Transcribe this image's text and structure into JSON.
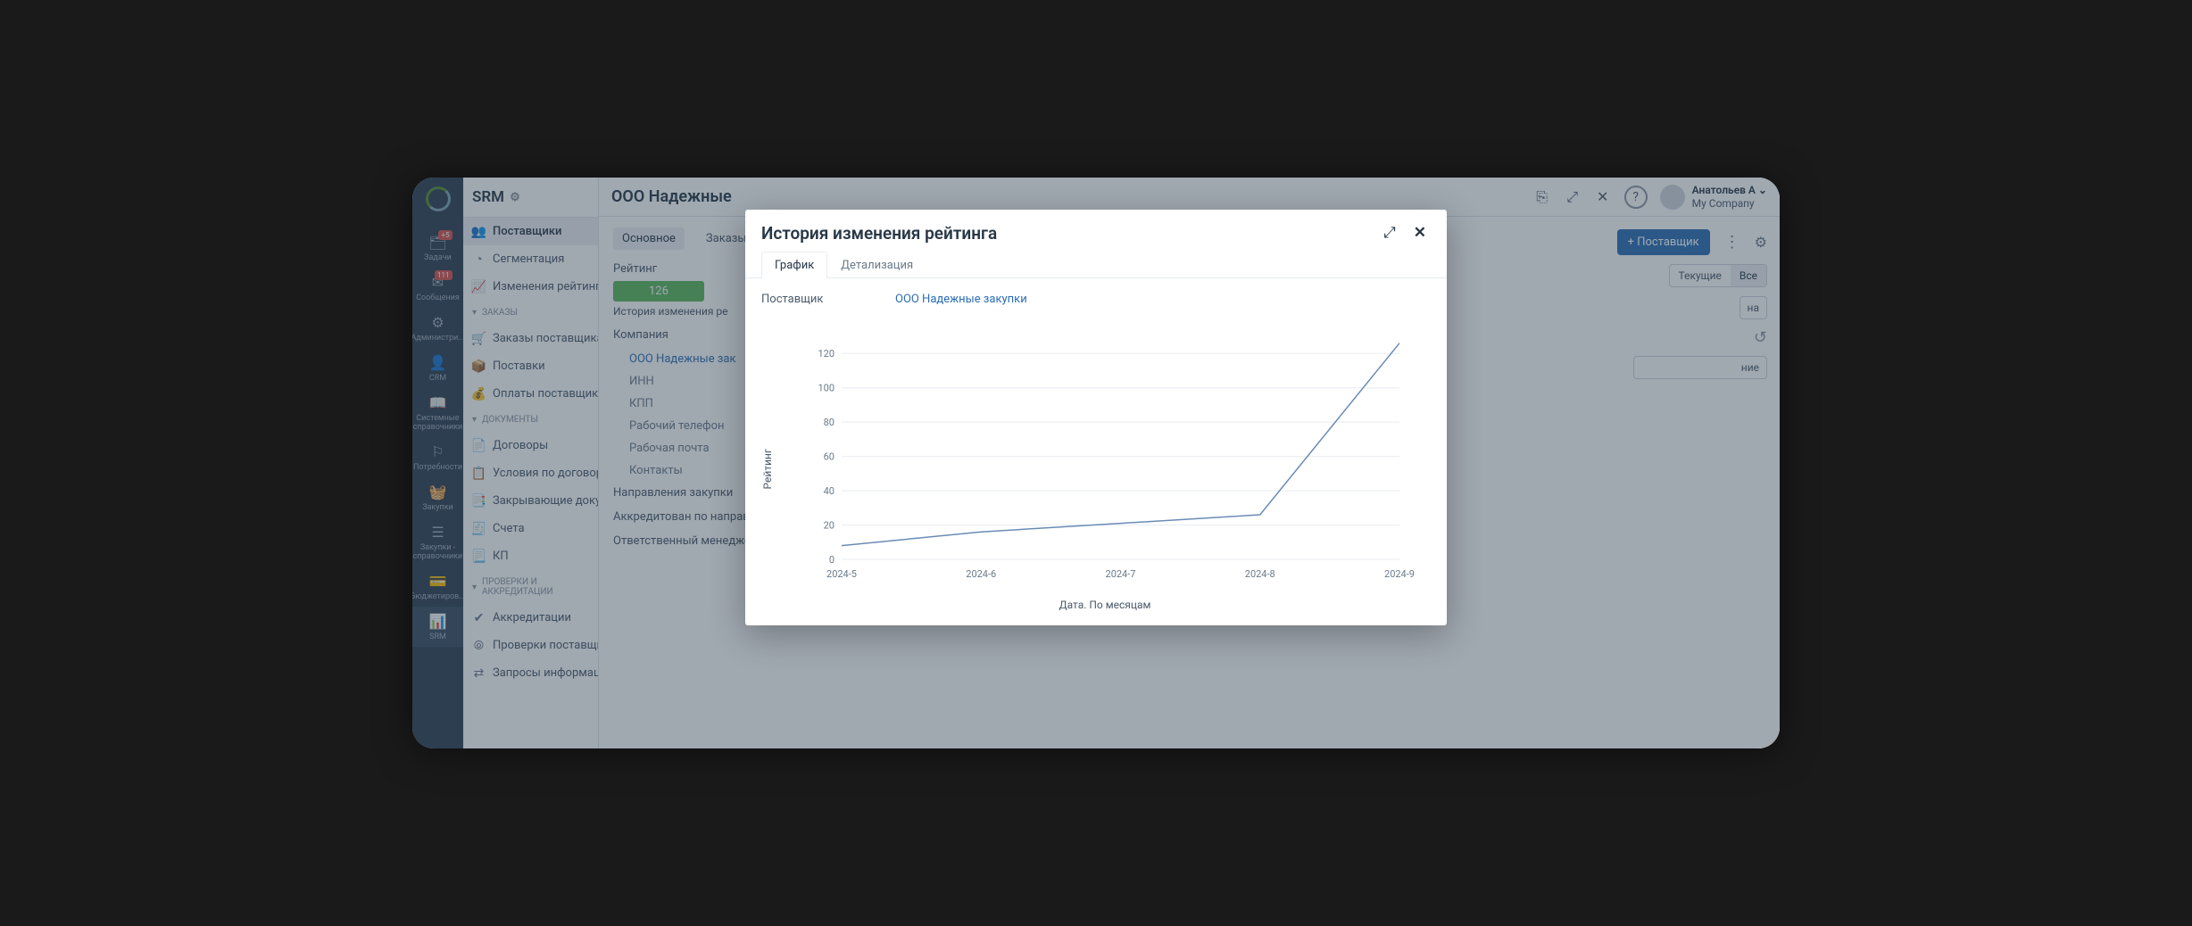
{
  "rail": {
    "items": [
      {
        "label": "Задачи",
        "badge": "+5"
      },
      {
        "label": "Сообщения",
        "badge": "111"
      },
      {
        "label": "Администри..."
      },
      {
        "label": "CRM"
      },
      {
        "label": "Системные справочники"
      },
      {
        "label": "Потребности"
      },
      {
        "label": "Закупки"
      },
      {
        "label": "Закупки - справочники"
      },
      {
        "label": "Бюджетиров..."
      },
      {
        "label": "SRM"
      }
    ]
  },
  "sidebar": {
    "title": "SRM",
    "items": [
      {
        "label": "Поставщики"
      },
      {
        "label": "Сегментация"
      },
      {
        "label": "Изменения рейтинга п"
      }
    ],
    "sec1": "ЗАКАЗЫ",
    "orders": [
      {
        "label": "Заказы поставщикам"
      },
      {
        "label": "Поставки"
      },
      {
        "label": "Оплаты поставщикам"
      }
    ],
    "sec2": "ДОКУМЕНТЫ",
    "docs": [
      {
        "label": "Договоры"
      },
      {
        "label": "Условия по договорам"
      },
      {
        "label": "Закрывающие докуме"
      },
      {
        "label": "Счета"
      },
      {
        "label": "КП"
      }
    ],
    "sec3": "ПРОВЕРКИ И АККРЕДИТАЦИИ",
    "checks": [
      {
        "label": "Аккредитации"
      },
      {
        "label": "Проверки поставщико"
      },
      {
        "label": "Запросы информации"
      }
    ]
  },
  "page": {
    "title": "ООО Надежные",
    "tabs": {
      "main": "Основное",
      "orders": "Заказы"
    },
    "form": {
      "rating_label": "Рейтинг",
      "rating_value": "126",
      "rating_history": "История изменения ре",
      "company_label": "Компания",
      "company_name": "ООО Надежные зак",
      "inn": "ИНН",
      "kpp": "КПП",
      "phone": "Рабочий телефон",
      "email": "Рабочая почта",
      "contacts": "Контакты",
      "directions": "Направления закупки",
      "accred": "Аккредитован по направлениям",
      "manager": "Ответственный менеджер"
    },
    "right": {
      "add_btn": "+ Поставщик",
      "seg_current": "Текущие",
      "seg_all": "Все",
      "extra_field": "на",
      "extra_field2": "ние"
    }
  },
  "user": {
    "name": "Анатольев А",
    "company": "My Company"
  },
  "modal": {
    "title": "История изменения рейтинга",
    "tabs": {
      "chart": "График",
      "detail": "Детализация"
    },
    "supplier_label": "Поставщик",
    "supplier_name": "ООО Надежные закупки"
  },
  "chart_data": {
    "type": "line",
    "categories": [
      "2024-5",
      "2024-6",
      "2024-7",
      "2024-8",
      "2024-9"
    ],
    "values": [
      8,
      16,
      21,
      26,
      126
    ],
    "ylabel": "Рейтинг",
    "xlabel": "Дата. По месяцам",
    "ylim": [
      0,
      130
    ],
    "yticks": [
      0,
      20,
      40,
      60,
      80,
      100,
      120
    ]
  }
}
